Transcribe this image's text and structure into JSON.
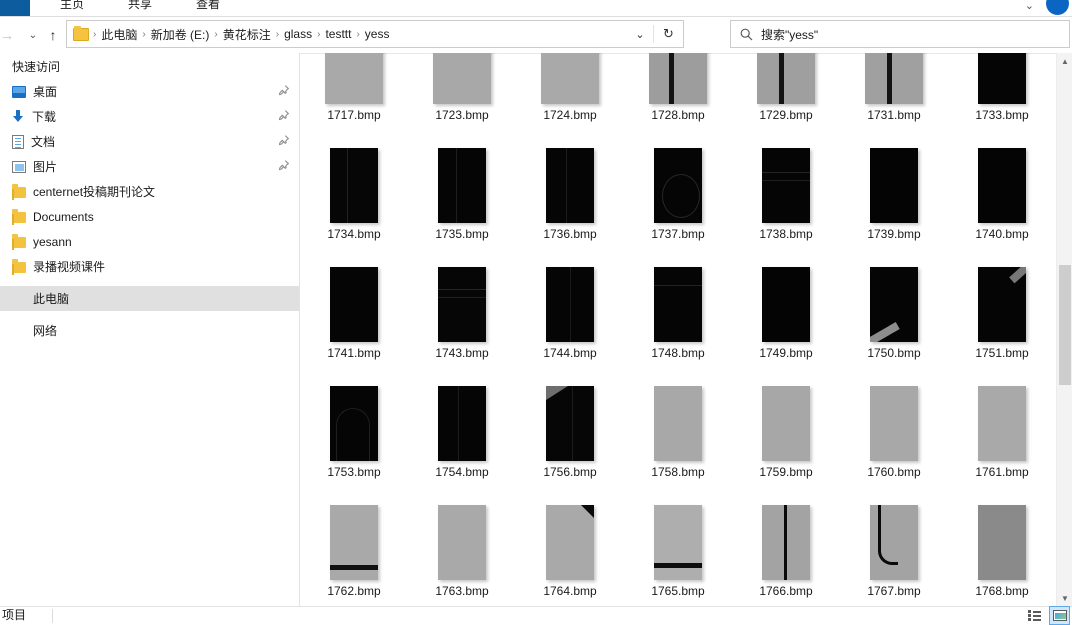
{
  "window": {
    "ribbon_tabs": [
      {
        "label": "主页",
        "name": "tab-home"
      },
      {
        "label": "共享",
        "name": "tab-share"
      },
      {
        "label": "查看",
        "name": "tab-view"
      }
    ],
    "expand_ribbon_icon": "chevron-down-icon",
    "help_icon": "help-icon",
    "accent_color": "#0c5c9e"
  },
  "navigation": {
    "back_icon": "arrow-left-icon",
    "forward_icon": "arrow-right-icon",
    "recent_icon": "chevron-down-icon",
    "up_icon": "arrow-up-icon",
    "forward_glyph": "→",
    "recent_glyph": "⌄",
    "up_glyph": "↑"
  },
  "address_bar": {
    "folder_icon": "folder-icon",
    "breadcrumbs": [
      "此电脑",
      "新加卷 (E:)",
      "黄花标注",
      "glass",
      "testtt",
      "yess"
    ],
    "separator": "›",
    "dropdown_glyph": "⌄",
    "refresh_glyph": "↻"
  },
  "search": {
    "icon": "search-icon",
    "placeholder": "搜索\"yess\"",
    "value": ""
  },
  "sidebar": {
    "groups": [
      {
        "title": "快速访问",
        "name": "nav-group-quick-access",
        "items": [
          {
            "label": "桌面",
            "icon": "desktop-icon",
            "pinned": true,
            "name": "sidebar-item-desktop"
          },
          {
            "label": "下载",
            "icon": "download-icon",
            "pinned": true,
            "name": "sidebar-item-downloads"
          },
          {
            "label": "文档",
            "icon": "document-icon",
            "pinned": true,
            "name": "sidebar-item-documents"
          },
          {
            "label": "图片",
            "icon": "picture-icon",
            "pinned": true,
            "name": "sidebar-item-pictures"
          },
          {
            "label": "centernet投稿期刊论文",
            "icon": "folder-icon",
            "pinned": false,
            "name": "sidebar-item-centernet"
          },
          {
            "label": "Documents",
            "icon": "folder-icon",
            "pinned": false,
            "name": "sidebar-item-documents-folder"
          },
          {
            "label": "yesann",
            "icon": "folder-icon",
            "pinned": false,
            "name": "sidebar-item-yesann"
          },
          {
            "label": "录播视频课件",
            "icon": "folder-icon",
            "pinned": false,
            "name": "sidebar-item-lubo"
          }
        ]
      }
    ],
    "this_pc": {
      "label": "此电脑",
      "name": "sidebar-item-this-pc",
      "selected": true
    },
    "network": {
      "label": "网络",
      "name": "sidebar-item-network",
      "selected": false
    },
    "pin_glyph": "📌",
    "selected_bg": "#e0e0e0"
  },
  "files": {
    "items": [
      {
        "name": "1717.bmp",
        "thumb": {
          "w": 58,
          "h": 58,
          "bg": "#a9a9a9",
          "marks": []
        }
      },
      {
        "name": "1723.bmp",
        "thumb": {
          "w": 58,
          "h": 58,
          "bg": "#a8a8a8",
          "marks": []
        }
      },
      {
        "name": "1724.bmp",
        "thumb": {
          "w": 58,
          "h": 58,
          "bg": "#a9a9a9",
          "marks": []
        }
      },
      {
        "name": "1728.bmp",
        "thumb": {
          "w": 58,
          "h": 58,
          "bg": "#9d9d9d",
          "marks": [
            {
              "type": "vline",
              "x": 20,
              "w": 5,
              "color": "#141414"
            }
          ]
        }
      },
      {
        "name": "1729.bmp",
        "thumb": {
          "w": 58,
          "h": 58,
          "bg": "#9f9f9f",
          "marks": [
            {
              "type": "vline",
              "x": 22,
              "w": 5,
              "color": "#141414"
            }
          ]
        }
      },
      {
        "name": "1731.bmp",
        "thumb": {
          "w": 58,
          "h": 58,
          "bg": "#a0a0a0",
          "marks": [
            {
              "type": "vline",
              "x": 22,
              "w": 5,
              "color": "#141414"
            }
          ]
        }
      },
      {
        "name": "1733.bmp",
        "thumb": {
          "w": 48,
          "h": 58,
          "bg": "#050505",
          "marks": []
        }
      },
      {
        "name": "1734.bmp",
        "thumb": {
          "w": 48,
          "h": 75,
          "bg": "#060606",
          "marks": [
            {
              "type": "vline",
              "x": 17,
              "w": 1,
              "color": "#222"
            }
          ]
        }
      },
      {
        "name": "1735.bmp",
        "thumb": {
          "w": 48,
          "h": 75,
          "bg": "#050505",
          "marks": [
            {
              "type": "vline",
              "x": 18,
              "w": 1,
              "color": "#1e1e1e"
            }
          ]
        }
      },
      {
        "name": "1736.bmp",
        "thumb": {
          "w": 48,
          "h": 75,
          "bg": "#050505",
          "marks": [
            {
              "type": "vline",
              "x": 20,
              "w": 1,
              "color": "#1e1e1e"
            }
          ]
        }
      },
      {
        "name": "1737.bmp",
        "thumb": {
          "w": 48,
          "h": 75,
          "bg": "#050505",
          "marks": [
            {
              "type": "arc",
              "color": "#262626"
            }
          ]
        }
      },
      {
        "name": "1738.bmp",
        "thumb": {
          "w": 48,
          "h": 75,
          "bg": "#050505",
          "marks": [
            {
              "type": "hline",
              "y": 24,
              "h": 1,
              "color": "#242424"
            },
            {
              "type": "hline",
              "y": 32,
              "h": 1,
              "color": "#1f1f1f"
            }
          ]
        }
      },
      {
        "name": "1739.bmp",
        "thumb": {
          "w": 48,
          "h": 75,
          "bg": "#040404",
          "marks": []
        }
      },
      {
        "name": "1740.bmp",
        "thumb": {
          "w": 48,
          "h": 75,
          "bg": "#040404",
          "marks": []
        }
      },
      {
        "name": "1741.bmp",
        "thumb": {
          "w": 48,
          "h": 75,
          "bg": "#050505",
          "marks": []
        }
      },
      {
        "name": "1743.bmp",
        "thumb": {
          "w": 48,
          "h": 75,
          "bg": "#060606",
          "marks": [
            {
              "type": "hline",
              "y": 22,
              "h": 1,
              "color": "#262626"
            },
            {
              "type": "hline",
              "y": 30,
              "h": 1,
              "color": "#202020"
            }
          ]
        }
      },
      {
        "name": "1744.bmp",
        "thumb": {
          "w": 48,
          "h": 75,
          "bg": "#050505",
          "marks": [
            {
              "type": "vline",
              "x": 24,
              "w": 1,
              "color": "#1a1a1a"
            }
          ]
        }
      },
      {
        "name": "1748.bmp",
        "thumb": {
          "w": 48,
          "h": 75,
          "bg": "#050505",
          "marks": [
            {
              "type": "hline",
              "y": 18,
              "h": 1,
              "color": "#232323"
            }
          ]
        }
      },
      {
        "name": "1749.bmp",
        "thumb": {
          "w": 48,
          "h": 75,
          "bg": "#040404",
          "marks": []
        }
      },
      {
        "name": "1750.bmp",
        "thumb": {
          "w": 48,
          "h": 75,
          "bg": "#050505",
          "marks": [
            {
              "type": "diag-bl",
              "color": "#8d8d8d"
            }
          ]
        }
      },
      {
        "name": "1751.bmp",
        "thumb": {
          "w": 48,
          "h": 75,
          "bg": "#050505",
          "marks": [
            {
              "type": "diag-tr",
              "color": "#777777"
            }
          ]
        }
      },
      {
        "name": "1753.bmp",
        "thumb": {
          "w": 48,
          "h": 75,
          "bg": "#050505",
          "marks": [
            {
              "type": "arc2",
              "color": "#1f1f1f"
            }
          ]
        }
      },
      {
        "name": "1754.bmp",
        "thumb": {
          "w": 48,
          "h": 75,
          "bg": "#050505",
          "marks": [
            {
              "type": "vline",
              "x": 20,
              "w": 1,
              "color": "#1c1c1c"
            }
          ]
        }
      },
      {
        "name": "1756.bmp",
        "thumb": {
          "w": 48,
          "h": 75,
          "bg": "#060606",
          "marks": [
            {
              "type": "tri-tl",
              "color": "#6e6e6e"
            },
            {
              "type": "vline",
              "x": 26,
              "w": 1,
              "color": "#1c1c1c"
            }
          ]
        }
      },
      {
        "name": "1758.bmp",
        "thumb": {
          "w": 48,
          "h": 75,
          "bg": "#a8a8a8",
          "marks": []
        }
      },
      {
        "name": "1759.bmp",
        "thumb": {
          "w": 48,
          "h": 75,
          "bg": "#a7a7a7",
          "marks": []
        }
      },
      {
        "name": "1760.bmp",
        "thumb": {
          "w": 48,
          "h": 75,
          "bg": "#a8a8a8",
          "marks": []
        }
      },
      {
        "name": "1761.bmp",
        "thumb": {
          "w": 48,
          "h": 75,
          "bg": "#a9a9a9",
          "marks": []
        }
      },
      {
        "name": "1762.bmp",
        "thumb": {
          "w": 48,
          "h": 75,
          "bg": "#a9a9a9",
          "marks": [
            {
              "type": "hline",
              "y": 60,
              "h": 5,
              "color": "#101010"
            }
          ]
        }
      },
      {
        "name": "1763.bmp",
        "thumb": {
          "w": 48,
          "h": 75,
          "bg": "#a9a9a9",
          "marks": []
        }
      },
      {
        "name": "1764.bmp",
        "thumb": {
          "w": 48,
          "h": 75,
          "bg": "#a9a9a9",
          "marks": [
            {
              "type": "corner-tr",
              "color": "#0a0a0a"
            }
          ]
        }
      },
      {
        "name": "1765.bmp",
        "thumb": {
          "w": 48,
          "h": 75,
          "bg": "#aeaeae",
          "marks": [
            {
              "type": "hline",
              "y": 58,
              "h": 5,
              "color": "#0d0d0d"
            }
          ]
        }
      },
      {
        "name": "1766.bmp",
        "thumb": {
          "w": 48,
          "h": 75,
          "bg": "#a3a3a3",
          "marks": [
            {
              "type": "vline",
              "x": 22,
              "w": 3,
              "color": "#0a0a0a"
            }
          ]
        }
      },
      {
        "name": "1767.bmp",
        "thumb": {
          "w": 48,
          "h": 75,
          "bg": "#a3a3a3",
          "marks": [
            {
              "type": "jcurve",
              "color": "#0a0a0a"
            }
          ]
        }
      },
      {
        "name": "1768.bmp",
        "thumb": {
          "w": 48,
          "h": 75,
          "bg": "#8a8a8a",
          "marks": []
        }
      }
    ]
  },
  "scrollbar": {
    "up_glyph": "▲",
    "down_glyph": "▼"
  },
  "status_bar": {
    "item_count_text": "项目",
    "views": [
      {
        "name": "details-view-button",
        "icon": "details-view-icon",
        "active": false
      },
      {
        "name": "large-icons-view-button",
        "icon": "large-icons-view-icon",
        "active": true
      }
    ]
  }
}
